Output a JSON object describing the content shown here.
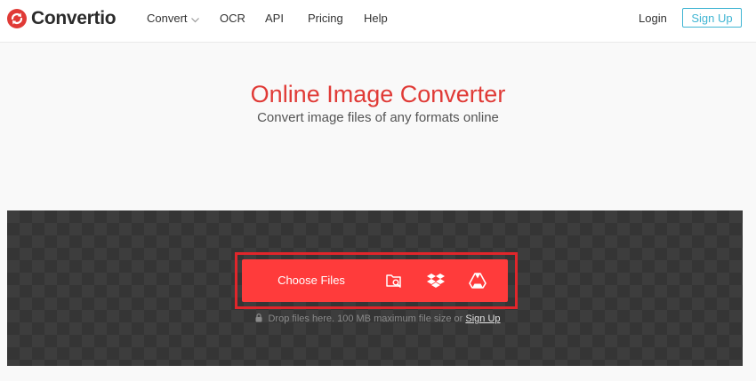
{
  "brand": {
    "name": "Convertio",
    "accent": "#e03a36",
    "button_red": "#ff3b3b",
    "signup_color": "#40b5d3"
  },
  "nav": {
    "items": [
      {
        "label": "Convert",
        "icon": "chevron-down-icon"
      },
      {
        "label": "OCR"
      },
      {
        "label": "API"
      },
      {
        "label": "Pricing"
      },
      {
        "label": "Help"
      }
    ],
    "login": "Login",
    "signup": "Sign Up"
  },
  "hero": {
    "title": "Online Image Converter",
    "subtitle": "Convert image files of any formats online"
  },
  "upload": {
    "choose_label": "Choose Files",
    "sources": [
      "folder-search-icon",
      "dropbox-icon",
      "google-drive-icon"
    ],
    "note_prefix": "Drop files here. 100 MB maximum file size or",
    "note_link": "Sign Up"
  }
}
